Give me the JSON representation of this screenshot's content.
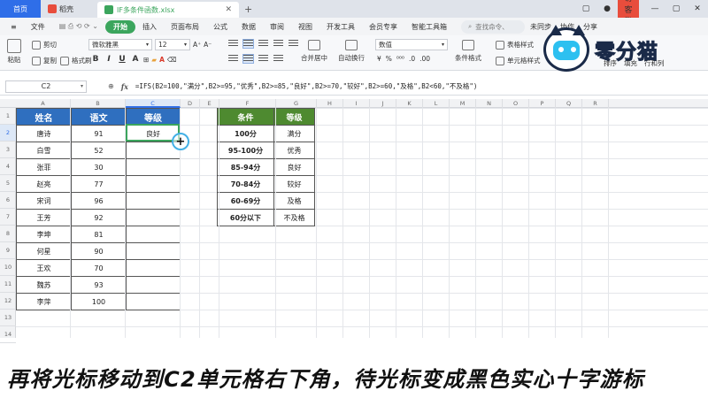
{
  "tabs": {
    "home": "首页",
    "docer": "稻壳",
    "file": "IF多条件函数.xlsx"
  },
  "visitor_label": "访客登",
  "menu": [
    "文件",
    "开始",
    "插入",
    "页面布局",
    "公式",
    "数据",
    "审阅",
    "视图",
    "开发工具",
    "会员专享",
    "智能工具箱"
  ],
  "menu_active": "开始",
  "search_placeholder": "查找命令、",
  "menu_right": [
    "未同步",
    "协作",
    "分享"
  ],
  "ribbon": {
    "paste": "粘贴",
    "cut": "剪切",
    "copy": "复制",
    "format_painter": "格式刷",
    "font_name": "微软雅黑",
    "font_size": "12",
    "merge_center": "合并居中",
    "wrap": "自动换行",
    "number_format": "数值",
    "conditional": "条件格式",
    "table_style": "表格样式",
    "cell_style": "单元格样式",
    "sort": "排序",
    "fill": "填充",
    "row_col": "行和列"
  },
  "logo_text": "零分猫",
  "name_box": "C2",
  "formula": "=IFS(B2=100,\"满分\",B2>=95,\"优秀\",B2>=85,\"良好\",B2>=70,\"较好\",B2>=60,\"及格\",B2<60,\"不及格\")",
  "columns": [
    "A",
    "B",
    "C",
    "D",
    "E",
    "F",
    "G",
    "H",
    "I",
    "J",
    "K",
    "L",
    "M",
    "N",
    "O",
    "P",
    "Q",
    "R"
  ],
  "rows": [
    "1",
    "2",
    "3",
    "4",
    "5",
    "6",
    "7",
    "8",
    "9",
    "10",
    "11",
    "12",
    "13",
    "14"
  ],
  "main_table": {
    "headers": [
      "姓名",
      "语文",
      "等级"
    ],
    "rows": [
      [
        "唐诗",
        "91",
        "良好"
      ],
      [
        "白雪",
        "52",
        ""
      ],
      [
        "张菲",
        "30",
        ""
      ],
      [
        "赵亮",
        "77",
        ""
      ],
      [
        "宋词",
        "96",
        ""
      ],
      [
        "王芳",
        "92",
        ""
      ],
      [
        "李坤",
        "81",
        ""
      ],
      [
        "何星",
        "90",
        ""
      ],
      [
        "王欢",
        "70",
        ""
      ],
      [
        "魏苏",
        "93",
        ""
      ],
      [
        "李萍",
        "100",
        ""
      ]
    ]
  },
  "cond_table": {
    "headers": [
      "条件",
      "等级"
    ],
    "rows": [
      [
        "100分",
        "满分"
      ],
      [
        "95-100分",
        "优秀"
      ],
      [
        "85-94分",
        "良好"
      ],
      [
        "70-84分",
        "较好"
      ],
      [
        "60-69分",
        "及格"
      ],
      [
        "60分以下",
        "不及格"
      ]
    ]
  },
  "subtitle": "再将光标移动到C2单元格右下角，待光标变成黑色实心十字游标",
  "colors": {
    "accent": "#2f6ee8",
    "header_blue": "#2f6fbf",
    "header_green": "#4e8a30",
    "active_green": "#3ba55d"
  }
}
